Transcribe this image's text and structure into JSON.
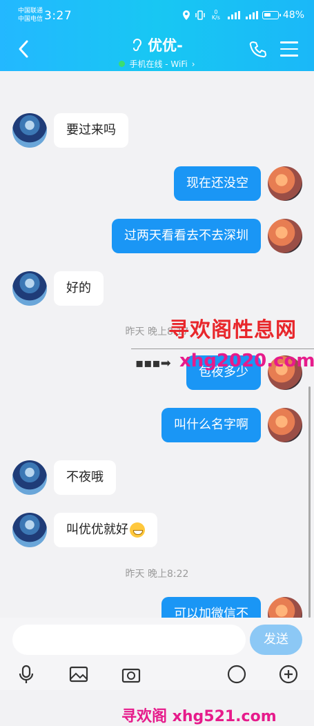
{
  "status_bar": {
    "carrier_1": "中国联通",
    "carrier_2": "中国电信",
    "time": "3:27",
    "net_speed": "0 K/s",
    "battery": "48%"
  },
  "header": {
    "contact_name": "优优-",
    "online_status": "手机在线 - WiFi",
    "chevron": "›"
  },
  "messages": [
    {
      "side": "in",
      "text": "要过来吗"
    },
    {
      "side": "out",
      "text": "现在还没空"
    },
    {
      "side": "out",
      "text": "过两天看看去不去深圳"
    },
    {
      "side": "in",
      "text": "好的"
    },
    {
      "side": "out",
      "text": "包夜多少"
    },
    {
      "side": "out",
      "text": "叫什么名字啊"
    },
    {
      "side": "in",
      "text": "不夜哦"
    },
    {
      "side": "in",
      "text": "叫优优就好"
    },
    {
      "side": "out",
      "text": "可以加微信不"
    }
  ],
  "timestamps": [
    "昨天 晚上8:17",
    "昨天 晚上8:22"
  ],
  "watermark": {
    "title": "寻欢阁性息网",
    "url": "xhg2020.com",
    "bottom": "寻欢阁 xhg521.com"
  },
  "input": {
    "placeholder": "",
    "send_label": "发送"
  },
  "icons": [
    "back-icon",
    "ear-icon",
    "phone-icon",
    "menu-icon",
    "mic-icon",
    "image-icon",
    "camera-icon",
    "add-icon"
  ]
}
